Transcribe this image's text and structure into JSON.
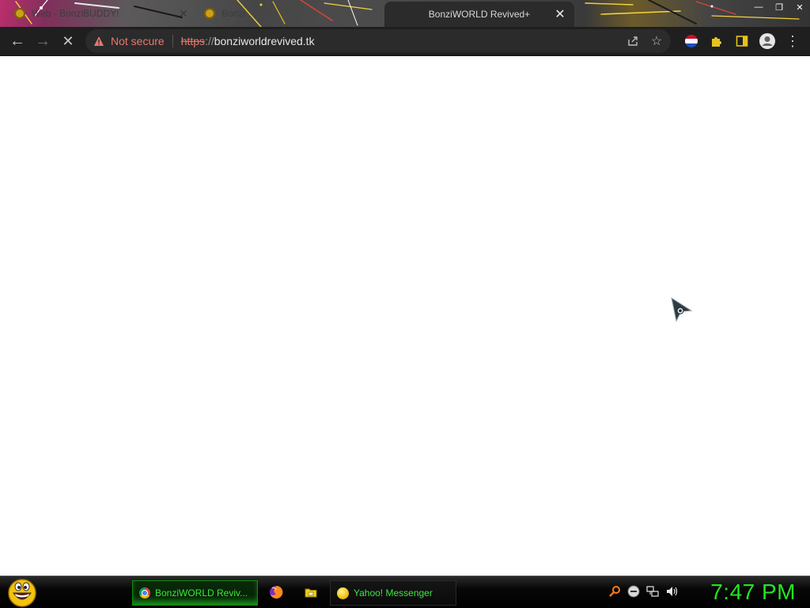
{
  "browser": {
    "tabs": [
      {
        "title": "Web - BonziBUDDY!",
        "close": "✕",
        "active": false
      },
      {
        "title": "Bonzi",
        "close": "✕",
        "active": false
      },
      {
        "title": "BonziWORLD Revived+",
        "close": "✕",
        "active": true
      }
    ],
    "window_controls": {
      "minimize": "—",
      "maximize": "❐",
      "close": "✕"
    },
    "toolbar": {
      "back": "←",
      "forward": "→",
      "stop": "✕",
      "menu": "⋮"
    },
    "address_bar": {
      "security_label": "Not secure",
      "scheme": "https",
      "separator": "://",
      "host": "bonziworldrevived.tk",
      "star": "☆"
    },
    "icons": [
      "warning-icon",
      "share-icon",
      "star-icon",
      "extension-flag-icon",
      "puzzle-icon",
      "side-panel-icon",
      "profile-icon",
      "menu-icon"
    ]
  },
  "page": {
    "state": "blank-loading"
  },
  "taskbar": {
    "tasks": [
      {
        "label": "BonziWORLD Reviv...",
        "app": "chrome",
        "active": true
      },
      {
        "label": "Yahoo! Messenger",
        "app": "yahoo-messenger",
        "active": false
      }
    ],
    "quick_launch": [
      "firefox-icon",
      "folder-icon"
    ],
    "tray": [
      "search-icon",
      "status-icon",
      "network-icon",
      "volume-icon"
    ],
    "clock": "7:47 PM"
  },
  "colors": {
    "accent_green": "#22e622",
    "security_red": "#e8776f",
    "toolbar_bg": "#1f1f1f",
    "tab_active_bg": "#2b2b2b"
  }
}
